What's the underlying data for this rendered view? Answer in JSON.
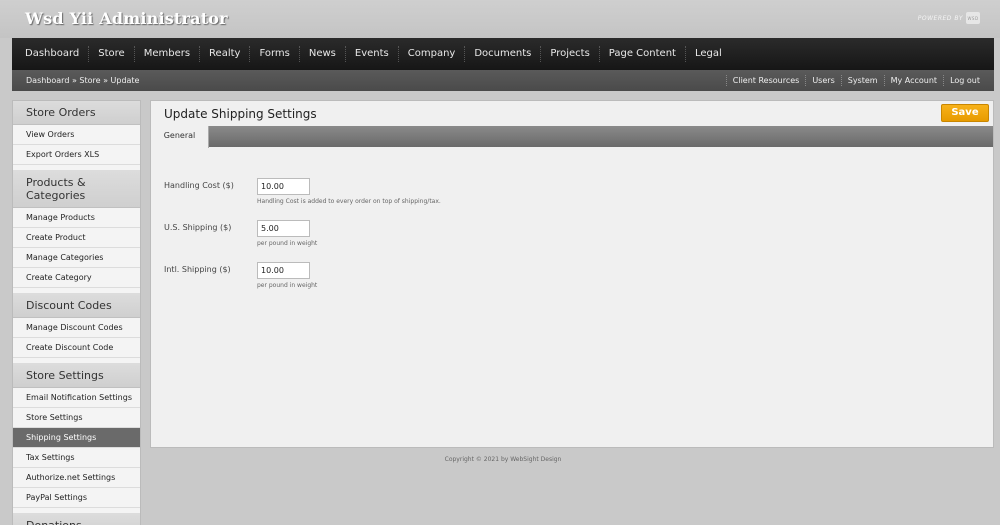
{
  "header": {
    "app_title": "Wsd Yii Administrator",
    "powered_by": "POWERED BY",
    "powered_logo": "WSD"
  },
  "nav": {
    "items": [
      "Dashboard",
      "Store",
      "Members",
      "Realty",
      "Forms",
      "News",
      "Events",
      "Company",
      "Documents",
      "Projects",
      "Page Content",
      "Legal"
    ]
  },
  "subbar": {
    "breadcrumb": "Dashboard » Store » Update",
    "links": [
      "Client Resources",
      "Users",
      "System",
      "My Account",
      "Log out"
    ]
  },
  "sidebar": {
    "sections": [
      {
        "title": "Store Orders",
        "items": [
          "View Orders",
          "Export Orders XLS"
        ]
      },
      {
        "title": "Products & Categories",
        "items": [
          "Manage Products",
          "Create Product",
          "Manage Categories",
          "Create Category"
        ]
      },
      {
        "title": "Discount Codes",
        "items": [
          "Manage Discount Codes",
          "Create Discount Code"
        ]
      },
      {
        "title": "Store Settings",
        "items": [
          "Email Notification Settings",
          "Store Settings",
          "Shipping Settings",
          "Tax Settings",
          "Authorize.net Settings",
          "PayPal Settings"
        ]
      },
      {
        "title": "Donations",
        "items": []
      }
    ],
    "active_item": "Shipping Settings"
  },
  "main": {
    "title": "Update Shipping Settings",
    "save_label": "Save",
    "tab_label": "General",
    "fields": [
      {
        "label": "Handling Cost ($)",
        "value": "10.00",
        "help": "Handling Cost is added to every order on top of shipping/tax."
      },
      {
        "label": "U.S. Shipping ($)",
        "value": "5.00",
        "help": "per pound in weight"
      },
      {
        "label": "Intl. Shipping ($)",
        "value": "10.00",
        "help": "per pound in weight"
      }
    ]
  },
  "footer": {
    "copyright": "Copyright © 2021 by WebSight Design"
  },
  "colors": {
    "accent": "#f0a500",
    "nav_bg": "#1e1e1e",
    "active_side": "#6a6a6a"
  }
}
